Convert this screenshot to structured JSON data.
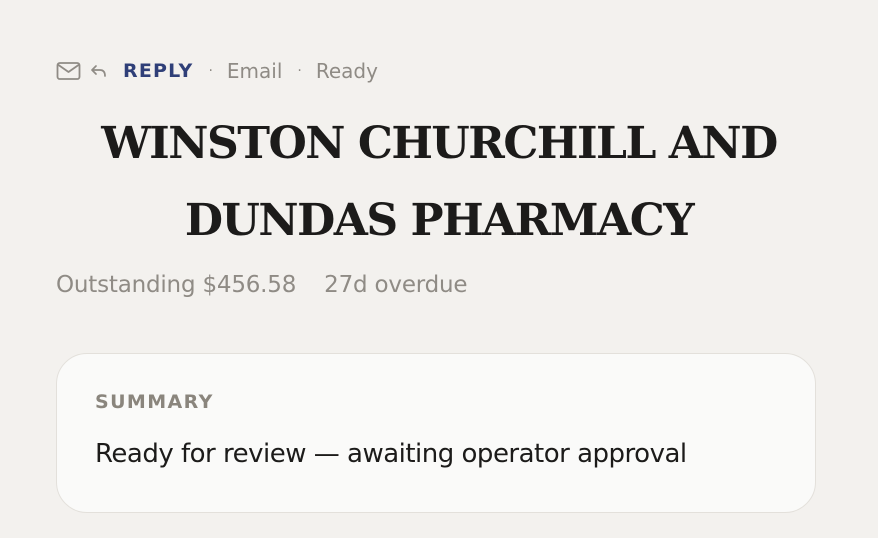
{
  "header": {
    "icons": {
      "mail": "mail-icon",
      "reply": "reply-icon"
    },
    "mode": "REPLY",
    "separator": "·",
    "channel": "Email",
    "status": "Ready"
  },
  "customer": {
    "name": "WINSTON CHURCHILL AND DUNDAS PHARMACY"
  },
  "balance": {
    "outstanding": "Outstanding $456.58",
    "overdue": "27d overdue"
  },
  "summary": {
    "heading": "SUMMARY",
    "text": "Ready for review — awaiting operator approval"
  },
  "colors": {
    "background": "#f3f1ee",
    "accent": "#2f3f78",
    "muted": "#8f8b85",
    "card": "#fafaf9",
    "text": "#1c1b1a"
  }
}
